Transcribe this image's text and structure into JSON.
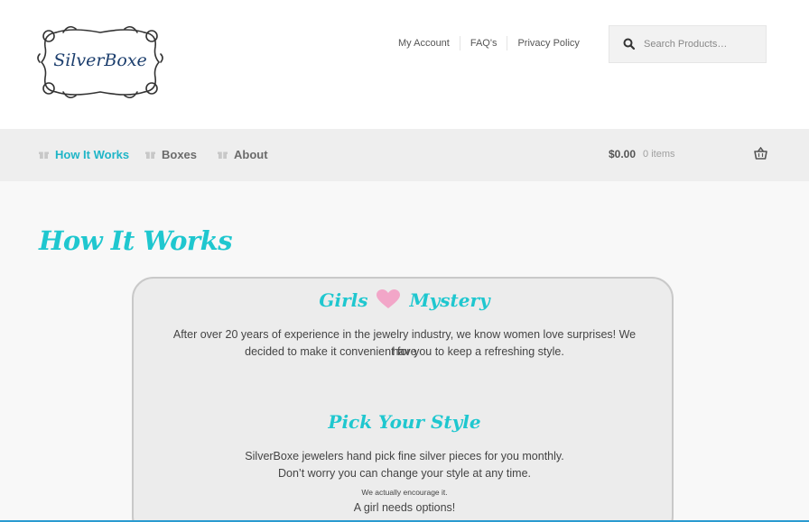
{
  "logo": {
    "text": "SilverBoxe"
  },
  "secondary_nav": [
    "My Account",
    "FAQ's",
    "Privacy Policy"
  ],
  "search": {
    "placeholder": "Search Products…"
  },
  "primary_nav": [
    {
      "label": "How It Works",
      "active": true
    },
    {
      "label": "Boxes",
      "active": false
    },
    {
      "label": "About",
      "active": false
    }
  ],
  "cart": {
    "total": "$0.00",
    "count": "0 items"
  },
  "page": {
    "title": "How It Works"
  },
  "sections": [
    {
      "title_left": "Girls",
      "title_right": "Mystery",
      "lines": [
        "After over 20 years of experience in the jewelry industry, we know women love surprises! We have",
        "decided to make it convenient for you to keep a refreshing style."
      ]
    },
    {
      "title": "Pick Your Style",
      "lines": [
        "SilverBoxe jewelers hand pick fine silver pieces for you monthly.",
        "Don’t worry you can change your style at any time."
      ],
      "small_line": "We actually encourage it.",
      "last_line": "A girl needs options!"
    }
  ],
  "colors": {
    "accent": "#1fc7cf",
    "nav_active": "#1fb5c7",
    "heart": "#f2a6c8"
  },
  "icons": [
    "search-icon",
    "gift-icon",
    "basket-icon",
    "heart-icon"
  ]
}
